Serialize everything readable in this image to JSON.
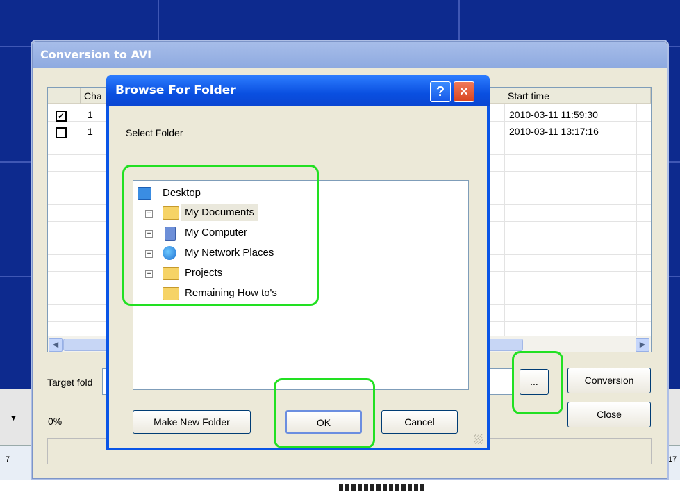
{
  "conversion_window": {
    "title": "Conversion to AVI",
    "columns": [
      "",
      "Cha",
      "Start time"
    ],
    "rows": [
      {
        "checked": true,
        "channel": "1",
        "start_time": "2010-03-11 11:59:30"
      },
      {
        "checked": false,
        "channel": "1",
        "start_time": "2010-03-11 13:17:16"
      }
    ],
    "target_folder_label": "Target fold",
    "browse_label": "...",
    "conversion_label": "Conversion",
    "close_label": "Close",
    "progress_text": "0%"
  },
  "browse_dialog": {
    "title": "Browse For Folder",
    "help_label": "?",
    "close_label": "×",
    "prompt": "Select Folder",
    "tree": [
      {
        "label": "Desktop",
        "icon": "desktop-icon"
      },
      {
        "label": "My Documents",
        "icon": "my-documents-icon",
        "expandable": true,
        "selected": true
      },
      {
        "label": "My Computer",
        "icon": "my-computer-icon",
        "expandable": true
      },
      {
        "label": "My Network Places",
        "icon": "network-places-icon",
        "expandable": true
      },
      {
        "label": "Projects",
        "icon": "folder-icon",
        "expandable": true
      },
      {
        "label": "Remaining How to's",
        "icon": "folder-icon",
        "expandable": false
      }
    ],
    "make_new_folder_label": "Make New Folder",
    "ok_label": "OK",
    "cancel_label": "Cancel"
  },
  "timeline": {
    "left_tick": "7",
    "right_tick": "17"
  },
  "colors": {
    "highlight": "#22e022",
    "xp_blue": "#0a55e6",
    "window_face": "#ece9d8"
  }
}
